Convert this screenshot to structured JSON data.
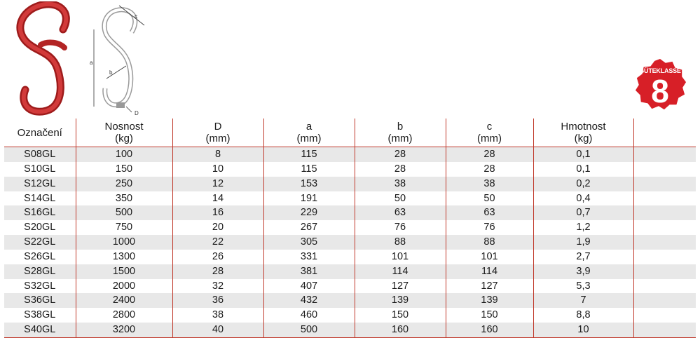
{
  "badge": {
    "text": "GÜTEKLASSE",
    "digit": "8",
    "color": "#d71f27"
  },
  "drawing": {
    "dim_c": "c",
    "dim_a": "a",
    "dim_b": "b",
    "dim_D": "D"
  },
  "table": {
    "accent_color": "#c0392b",
    "columns": [
      {
        "label": "Označení",
        "unit": ""
      },
      {
        "label": "Nosnost",
        "unit": "(kg)"
      },
      {
        "label": "D",
        "unit": "(mm)"
      },
      {
        "label": "a",
        "unit": "(mm)"
      },
      {
        "label": "b",
        "unit": "(mm)"
      },
      {
        "label": "c",
        "unit": "(mm)"
      },
      {
        "label": "Hmotnost",
        "unit": "(kg)"
      },
      {
        "label": "",
        "unit": ""
      }
    ],
    "rows": [
      [
        "S08GL",
        "100",
        "8",
        "115",
        "28",
        "28",
        "0,1",
        ""
      ],
      [
        "S10GL",
        "150",
        "10",
        "115",
        "28",
        "28",
        "0,1",
        ""
      ],
      [
        "S12GL",
        "250",
        "12",
        "153",
        "38",
        "38",
        "0,2",
        ""
      ],
      [
        "S14GL",
        "350",
        "14",
        "191",
        "50",
        "50",
        "0,4",
        ""
      ],
      [
        "S16GL",
        "500",
        "16",
        "229",
        "63",
        "63",
        "0,7",
        ""
      ],
      [
        "S20GL",
        "750",
        "20",
        "267",
        "76",
        "76",
        "1,2",
        ""
      ],
      [
        "S22GL",
        "1000",
        "22",
        "305",
        "88",
        "88",
        "1,9",
        ""
      ],
      [
        "S26GL",
        "1300",
        "26",
        "331",
        "101",
        "101",
        "2,7",
        ""
      ],
      [
        "S28GL",
        "1500",
        "28",
        "381",
        "114",
        "114",
        "3,9",
        ""
      ],
      [
        "S32GL",
        "2000",
        "32",
        "407",
        "127",
        "127",
        "5,3",
        ""
      ],
      [
        "S36GL",
        "2400",
        "36",
        "432",
        "139",
        "139",
        "7",
        ""
      ],
      [
        "S38GL",
        "2800",
        "38",
        "460",
        "150",
        "150",
        "8,8",
        ""
      ],
      [
        "S40GL",
        "3200",
        "40",
        "500",
        "160",
        "160",
        "10",
        ""
      ]
    ]
  }
}
